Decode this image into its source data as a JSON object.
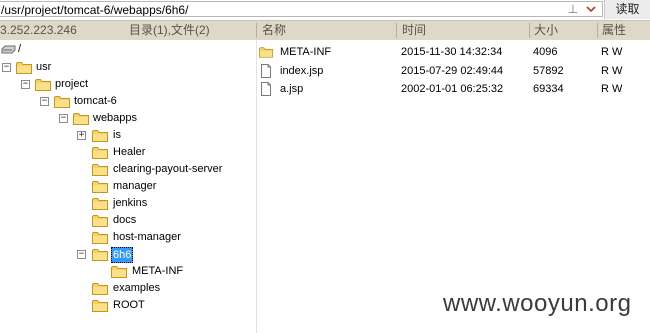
{
  "toolbar": {
    "path": "/usr/project/tomcat-6/webapps/6h6/",
    "pin_icon": "pin-icon",
    "read_button": "读取"
  },
  "header": {
    "ip": "3.252.223.246",
    "tree_summary": "目录(1),文件(2)",
    "columns": [
      "名称",
      "时间",
      "大小",
      "属性"
    ]
  },
  "tree": {
    "root": "/",
    "usr": "usr",
    "project": "project",
    "tomcat": "tomcat-6",
    "webapps": "webapps",
    "children": [
      "is",
      "Healer",
      "clearing-payout-server",
      "manager",
      "jenkins",
      "docs",
      "host-manager",
      "6h6",
      "examples",
      "ROOT"
    ],
    "meta": "META-INF",
    "toggle_minus": "−",
    "toggle_plus": "+"
  },
  "files": [
    {
      "name": "META-INF",
      "time": "2015-11-30 14:32:34",
      "size": "4096",
      "attr": "R W",
      "icon": "folder-icon"
    },
    {
      "name": "index.jsp",
      "time": "2015-07-29 02:49:44",
      "size": "57892",
      "attr": "R W",
      "icon": "file-icon"
    },
    {
      "name": "a.jsp",
      "time": "2002-01-01 06:25:32",
      "size": "69334",
      "attr": "R W",
      "icon": "file-icon"
    }
  ],
  "watermark": "www.wooyun.org",
  "colors": {
    "header_bg": "#ddd8c8",
    "folder": "#f2c84b",
    "selection": "#3399ff"
  }
}
